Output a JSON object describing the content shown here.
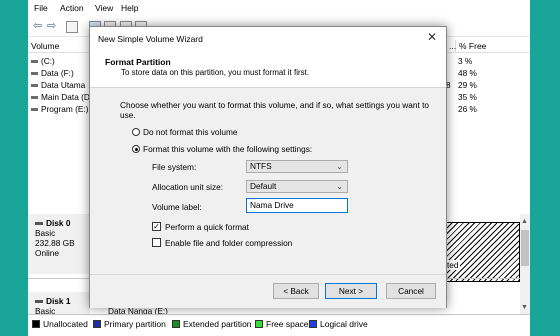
{
  "menu": [
    "File",
    "Action",
    "View",
    "Help"
  ],
  "volume_header": {
    "volume": "Volume",
    "ellipsis": "...",
    "pct_free": "% Free"
  },
  "volumes": [
    {
      "name": "(C:)",
      "pct": "3 %"
    },
    {
      "name": "Data (F:)",
      "pct": "48 %"
    },
    {
      "name": "Data Utama",
      "pct": "29 %"
    },
    {
      "name": "Main Data (D",
      "pct": "35 %"
    },
    {
      "name": "Program (E:)",
      "pct": "26 %"
    }
  ],
  "fragment_8": "8",
  "disks": [
    {
      "name": "Disk 0",
      "type": "Basic",
      "size": "232.88 GB",
      "status": "Online"
    },
    {
      "name": "Disk 1",
      "type": "Basic",
      "partition_fragment": "Data Nanga (E:)"
    }
  ],
  "hatch_fragment": "ted",
  "legend": [
    {
      "label": "Unallocated",
      "color": "#000000"
    },
    {
      "label": "Primary partition",
      "color": "#1a2fa8"
    },
    {
      "label": "Extended partition",
      "color": "#1f8f1f"
    },
    {
      "label": "Free space",
      "color": "#33dd33"
    },
    {
      "label": "Logical drive",
      "color": "#1f3fe0"
    }
  ],
  "dialog": {
    "title": "New Simple Volume Wizard",
    "header_title": "Format Partition",
    "header_subtitle": "To store data on this partition, you must format it first.",
    "intro": "Choose whether you want to format this volume, and if so, what settings you want to use.",
    "radio_no_format": "Do not format this volume",
    "radio_format": "Format this volume with the following settings:",
    "fs_label": "File system:",
    "fs_value": "NTFS",
    "alloc_label": "Allocation unit size:",
    "alloc_value": "Default",
    "vol_label": "Volume label:",
    "vol_value": "Nama Drive",
    "quick_format": "Perform a quick format",
    "compression": "Enable file and folder compression",
    "back": "< Back",
    "next": "Next >",
    "cancel": "Cancel"
  }
}
